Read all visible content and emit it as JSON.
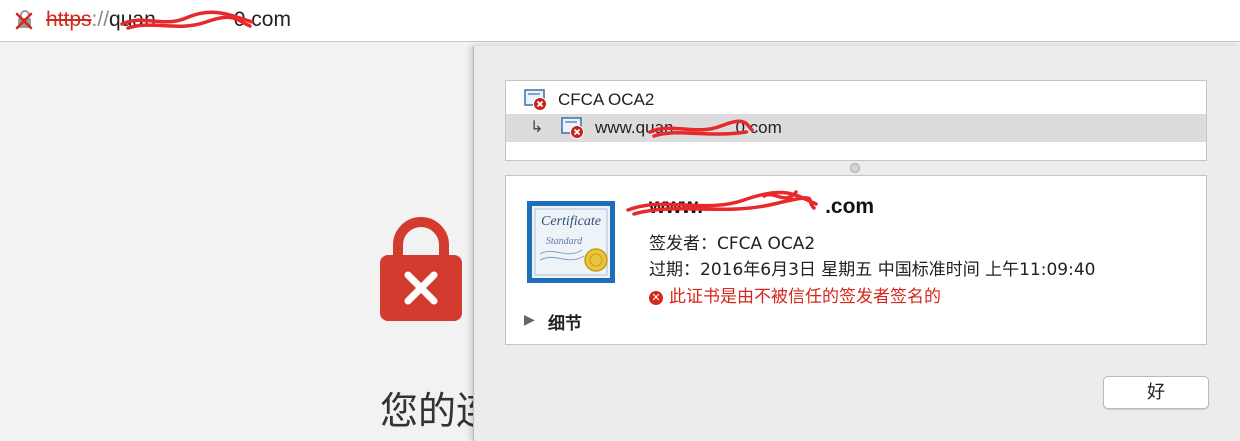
{
  "address_bar": {
    "scheme": "https",
    "separator": "://",
    "host_visible_start": "quan",
    "host_visible_end": "0.com",
    "icon": "lock-broken-icon",
    "scheme_color": "#d22a1f"
  },
  "page": {
    "heading_fragment": "您的连",
    "lock_icon": "lock-error-icon",
    "lock_color": "#d33b2f"
  },
  "cert_sheet": {
    "chain": [
      {
        "label": "CFCA OCA2",
        "icon": "certificate-error-icon",
        "selected": false
      },
      {
        "label": "www.quan",
        "label_tail": "0.com",
        "icon": "certificate-error-icon",
        "selected": true,
        "child_arrow": "↳"
      }
    ],
    "details": {
      "cert_image_text": "Certificate",
      "cert_image_subtext": "Standard",
      "name_start": "www.",
      "name_end": ".com",
      "issuer_label": "签发者：",
      "issuer": "CFCA OCA2",
      "expiry_label": "过期：",
      "expiry": "2016年6月3日 星期五 中国标准时间 上午11:09:40",
      "error_icon": "error-circle-icon",
      "error": "此证书是由不被信任的签发者签名的",
      "error_color": "#d7261b",
      "disclosure_icon": "disclosure-triangle-icon",
      "disclosure_label": "细节"
    },
    "ok_button": "好"
  }
}
